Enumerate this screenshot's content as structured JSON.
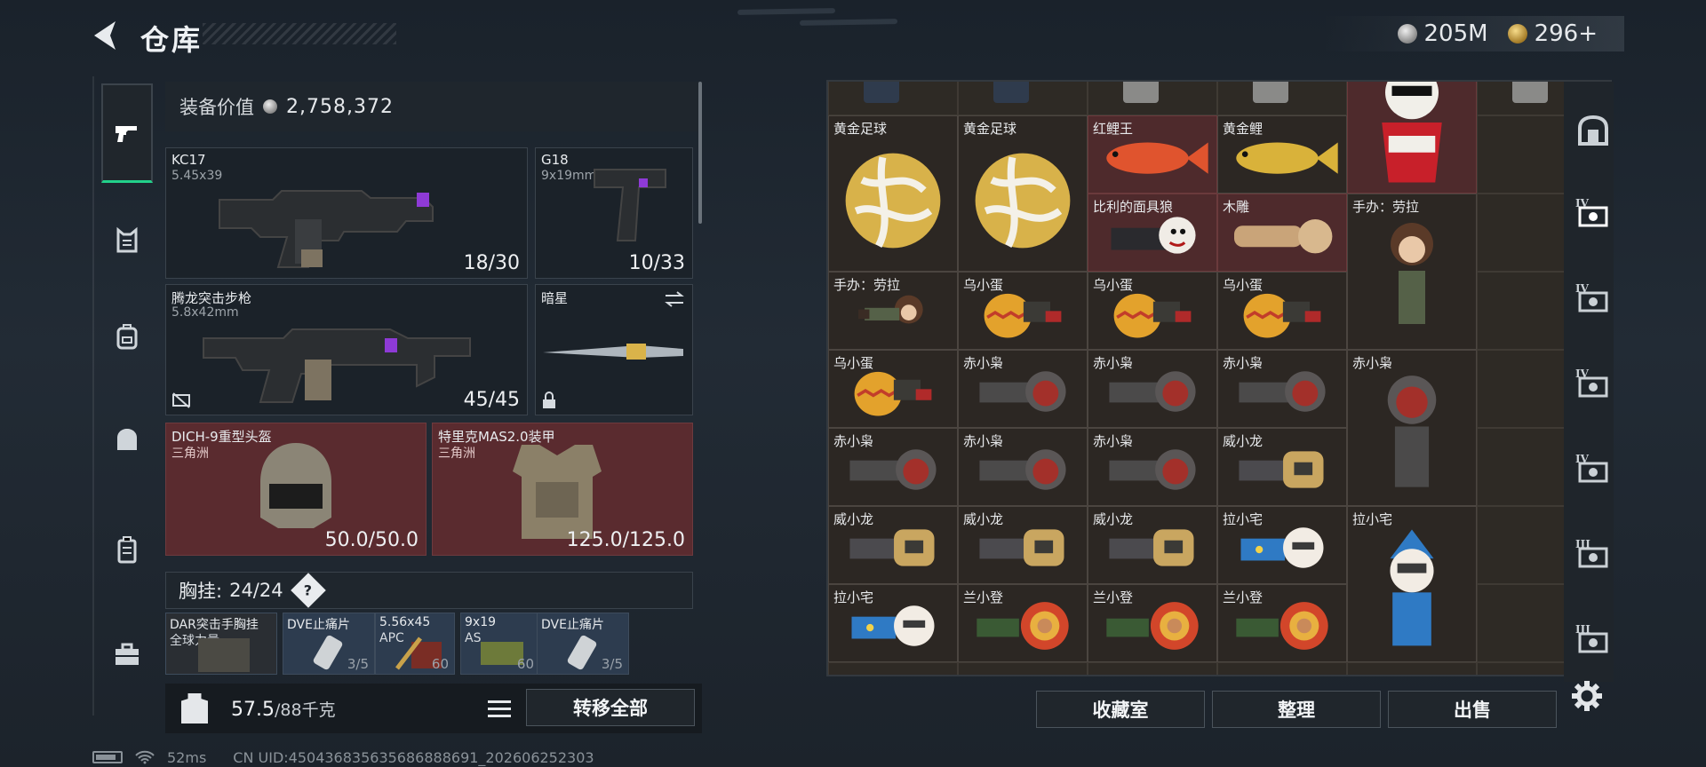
{
  "header": {
    "title": "仓库",
    "currency": [
      {
        "icon": "silver-coin-icon",
        "value": "205M"
      },
      {
        "icon": "gold-coin-icon",
        "value": "296+"
      }
    ]
  },
  "left_nav": [
    {
      "icon": "pistol-icon",
      "active": true
    },
    {
      "icon": "armor-vest-icon"
    },
    {
      "icon": "backpack-icon"
    },
    {
      "icon": "bag-icon"
    },
    {
      "icon": "case-icon"
    },
    {
      "icon": "toolbox-icon"
    }
  ],
  "equipment": {
    "value_label": "装备价值",
    "value": "2,758,372",
    "primary": {
      "name": "KC17",
      "caliber": "5.45x39",
      "ammo": "18/30"
    },
    "secondary": {
      "name": "G18",
      "caliber": "9x19mm",
      "ammo": "10/33"
    },
    "rifle": {
      "name": "腾龙突击步枪",
      "caliber": "5.8x42mm",
      "ammo": "45/45"
    },
    "melee": {
      "name": "暗星"
    },
    "helmet": {
      "name": "DICH-9重型头盔",
      "origin": "三角洲",
      "durability": "50.0/50.0"
    },
    "armor": {
      "name": "特里克MAS2.0装甲",
      "origin": "三角洲",
      "durability": "125.0/125.0"
    },
    "chest_rig": {
      "label": "胸挂:",
      "capacity": "24/24",
      "help": "?"
    },
    "rig_items": [
      {
        "line1": "DAR突击手胸挂",
        "line2": "全球力量",
        "count": ""
      },
      {
        "line1": "DVE止痛片",
        "line2": "",
        "count": "3/5"
      },
      {
        "line1": "5.56x45",
        "line2": "APC",
        "count": "60"
      },
      {
        "line1": "9x19",
        "line2": "AS",
        "count": "60"
      },
      {
        "line1": "DVE止痛片",
        "line2": "",
        "count": "3/5"
      }
    ]
  },
  "weight": {
    "current": "57.5",
    "max": "/88千克"
  },
  "actions": {
    "transfer_all": "转移全部"
  },
  "status_bar": {
    "ping": "52ms",
    "uid": "CN UID:450436835635686888691_202606252303"
  },
  "stash": {
    "items": [
      {
        "name": "黄金足球",
        "art": "golden-ball",
        "red": false
      },
      {
        "name": "黄金足球",
        "art": "golden-ball",
        "red": false
      },
      {
        "name": "红鲤王",
        "art": "red-koi",
        "red": true
      },
      {
        "name": "黄金鲤",
        "art": "gold-koi",
        "red": false
      },
      {
        "name": "",
        "art": "kfc-figure",
        "red": true
      },
      {
        "name": "比利的面具狼",
        "art": "billy-mask",
        "red": true
      },
      {
        "name": "木雕",
        "art": "wood-carving",
        "red": true
      },
      {
        "name": "手办：劳拉",
        "art": "lara-figure",
        "red": false
      },
      {
        "name": "手办：劳拉",
        "art": "lara-figure",
        "red": false
      },
      {
        "name": "乌小蛋",
        "art": "egg-figure",
        "red": false
      },
      {
        "name": "乌小蛋",
        "art": "egg-figure",
        "red": false
      },
      {
        "name": "乌小蛋",
        "art": "egg-figure",
        "red": false
      },
      {
        "name": "乌小蛋",
        "art": "egg-figure",
        "red": false
      },
      {
        "name": "赤小枭",
        "art": "red-hood",
        "red": false
      },
      {
        "name": "赤小枭",
        "art": "red-hood",
        "red": false
      },
      {
        "name": "赤小枭",
        "art": "red-hood",
        "red": false
      },
      {
        "name": "赤小枭",
        "art": "red-hood",
        "red": false
      },
      {
        "name": "赤小枭",
        "art": "red-hood",
        "red": false
      },
      {
        "name": "赤小枭",
        "art": "red-hood",
        "red": false
      },
      {
        "name": "赤小枭",
        "art": "red-hood",
        "red": false
      },
      {
        "name": "威小龙",
        "art": "dragon-figure",
        "red": false
      },
      {
        "name": "威小龙",
        "art": "dragon-figure",
        "red": false
      },
      {
        "name": "威小龙",
        "art": "dragon-figure",
        "red": false
      },
      {
        "name": "威小龙",
        "art": "dragon-figure",
        "red": false
      },
      {
        "name": "拉小宅",
        "art": "blue-figure",
        "red": false
      },
      {
        "name": "拉小宅",
        "art": "blue-figure",
        "red": false
      },
      {
        "name": "拉小宅",
        "art": "blue-figure",
        "red": false
      },
      {
        "name": "兰小登",
        "art": "sombrero-figure",
        "red": false
      },
      {
        "name": "兰小登",
        "art": "sombrero-figure",
        "red": false
      },
      {
        "name": "兰小登",
        "art": "sombrero-figure",
        "red": false
      }
    ],
    "buttons": {
      "collection": "收藏室",
      "sort": "整理",
      "sell": "出售"
    }
  },
  "right_nav": [
    {
      "icon": "stash-home-icon",
      "tag": ""
    },
    {
      "icon": "stash-tab-4-icon",
      "tag": "IV"
    },
    {
      "icon": "stash-tab-4b-icon",
      "tag": "IV"
    },
    {
      "icon": "stash-tab-4c-icon",
      "tag": "IV"
    },
    {
      "icon": "stash-tab-4-add-icon",
      "tag": "IV"
    },
    {
      "icon": "stash-tab-3-icon",
      "tag": "III"
    },
    {
      "icon": "stash-tab-3b-icon",
      "tag": "III"
    }
  ],
  "colors": {
    "accent": "#22d18b",
    "red_item": "#4e2a2c",
    "panel": "#1b2229"
  }
}
